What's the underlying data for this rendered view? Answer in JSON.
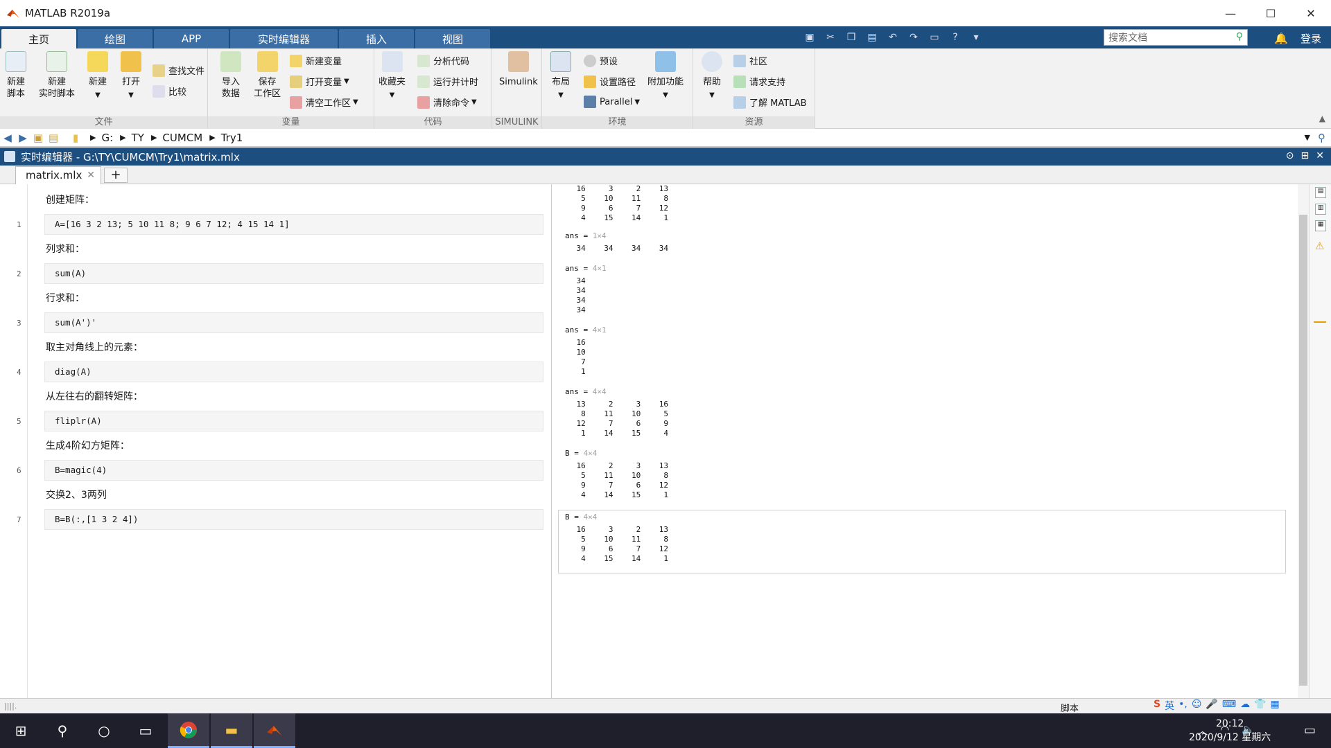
{
  "app": {
    "title": "MATLAB R2019a"
  },
  "window_controls": {
    "minimize": "—",
    "maximize": "☐",
    "close": "✕"
  },
  "ribbon_tabs": [
    "主页",
    "绘图",
    "APP",
    "实时编辑器",
    "插入",
    "视图"
  ],
  "search": {
    "placeholder": "搜索文档"
  },
  "login": "登录",
  "ribbon": {
    "file": {
      "label": "文件",
      "new_script": "新建\n脚本",
      "new_live": "新建\n实时脚本",
      "new": "新建",
      "open": "打开",
      "find_files": "查找文件",
      "compare": "比较"
    },
    "variable": {
      "label": "变量",
      "import": "导入\n数据",
      "save_ws": "保存\n工作区",
      "new_var": "新建变量",
      "open_var": "打开变量",
      "clear_ws": "清空工作区"
    },
    "code": {
      "label": "代码",
      "favorites": "收藏夹",
      "analyze": "分析代码",
      "run_time": "运行并计时",
      "clear_cmd": "清除命令"
    },
    "simulink": {
      "label": "SIMULINK",
      "simulink": "Simulink"
    },
    "env": {
      "label": "环境",
      "layout": "布局",
      "prefs": "预设",
      "set_path": "设置路径",
      "parallel": "Parallel",
      "addons": "附加功能"
    },
    "resources": {
      "label": "资源",
      "help": "帮助",
      "community": "社区",
      "support": "请求支持",
      "learn": "了解 MATLAB"
    }
  },
  "path": {
    "drive": "G:",
    "p1": "TY",
    "p2": "CUMCM",
    "p3": "Try1"
  },
  "editor": {
    "title": "实时编辑器 - G:\\TY\\CUMCM\\Try1\\matrix.mlx",
    "tab": "matrix.mlx"
  },
  "lines": [
    {
      "text": "创建矩阵：",
      "num": "1",
      "code": "A=[16 3 2 13; 5 10 11 8; 9 6 7 12; 4 15 14 1]"
    },
    {
      "text": "列求和：",
      "num": "2",
      "code": "sum(A)"
    },
    {
      "text": "行求和：",
      "num": "3",
      "code": "sum(A')'"
    },
    {
      "text": "取主对角线上的元素：",
      "num": "4",
      "code": "diag(A)"
    },
    {
      "text": "从左往右的翻转矩阵：",
      "num": "5",
      "code": "fliplr(A)"
    },
    {
      "text": "生成4阶幻方矩阵：",
      "num": "6",
      "code": "B=magic(4)"
    },
    {
      "text": "交换2、3两列",
      "num": "7",
      "code": "B=B(:,[1 3 2 4])"
    }
  ],
  "outputs": {
    "o0": "    16     3     2    13\n     5    10    11     8\n     9     6     7    12\n     4    15    14     1",
    "o1_label": "ans = ",
    "o1_dim": "1×4",
    "o1": "    34    34    34    34",
    "o2_label": "ans = ",
    "o2_dim": "4×1",
    "o2": "    34\n    34\n    34\n    34",
    "o3_label": "ans = ",
    "o3_dim": "4×1",
    "o3": "    16\n    10\n     7\n     1",
    "o4_label": "ans = ",
    "o4_dim": "4×4",
    "o4": "    13     2     3    16\n     8    11    10     5\n    12     7     6     9\n     1    14    15     4",
    "o5_label": "B = ",
    "o5_dim": "4×4",
    "o5": "    16     2     3    13\n     5    11    10     8\n     9     7     6    12\n     4    14    15     1",
    "o6_label": "B = ",
    "o6_dim": "4×4",
    "o6": "    16     3     2    13\n     5    10    11     8\n     9     6     7    12\n     4    15    14     1"
  },
  "status": {
    "mode": "脚本"
  },
  "ime": {
    "lang": "英"
  },
  "clock": {
    "time": "20:12",
    "date": "2020/9/12 星期六"
  }
}
